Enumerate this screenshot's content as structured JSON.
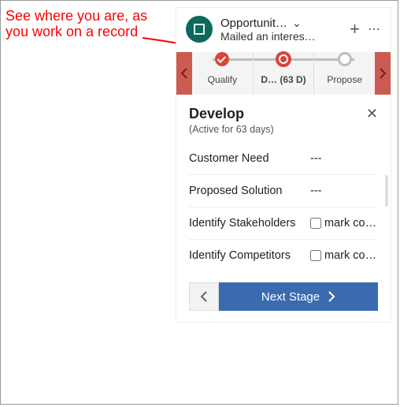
{
  "annotation": {
    "text": "See where you are, as you work on a record"
  },
  "header": {
    "record_type": "Opportunit…",
    "subtitle": "Mailed an interes…"
  },
  "stages": {
    "items": [
      {
        "label": "Qualify",
        "state": "done"
      },
      {
        "label": "D…   (63 D)",
        "state": "current"
      },
      {
        "label": "Propose",
        "state": "future"
      }
    ]
  },
  "flyout": {
    "title": "Develop",
    "subtitle": "(Active for 63 days)",
    "fields": [
      {
        "label": "Customer Need",
        "value": "---",
        "type": "text"
      },
      {
        "label": "Proposed Solution",
        "value": "---",
        "type": "text"
      },
      {
        "label": "Identify Stakeholders",
        "value": "mark co…",
        "type": "check"
      },
      {
        "label": "Identify Competitors",
        "value": "mark co…",
        "type": "check"
      }
    ],
    "next_label": "Next Stage"
  }
}
